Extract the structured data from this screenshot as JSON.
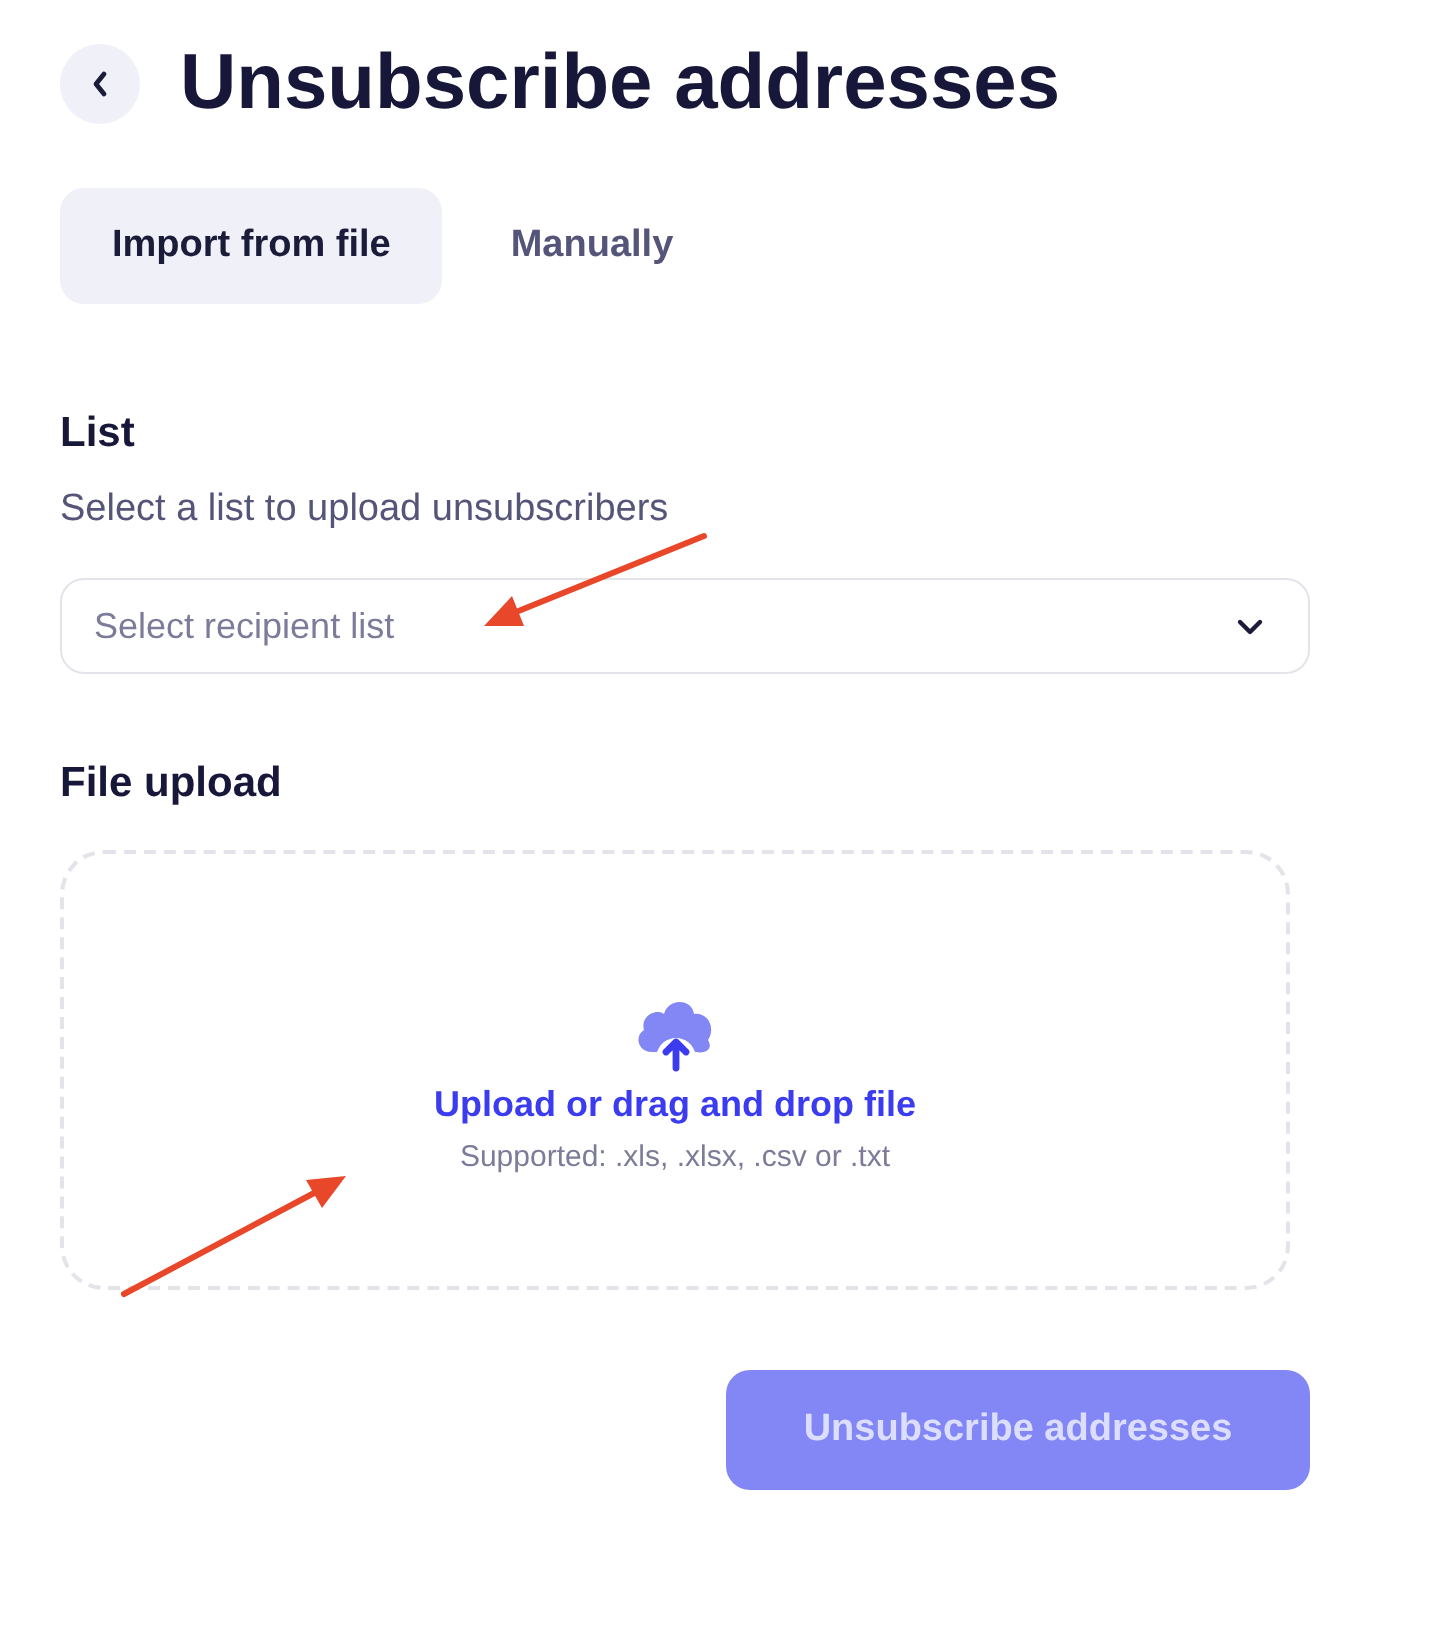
{
  "header": {
    "title": "Unsubscribe addresses"
  },
  "tabs": [
    {
      "label": "Import from file",
      "selected": true
    },
    {
      "label": "Manually",
      "selected": false
    }
  ],
  "list_section": {
    "label": "List",
    "description": "Select a list to upload unsubscribers",
    "select": {
      "placeholder": "Select recipient list"
    }
  },
  "upload_section": {
    "label": "File upload",
    "dropzone": {
      "action": "Upload or drag and drop file",
      "hint": "Supported: .xls, .xlsx, .csv or .txt"
    }
  },
  "submit_button": {
    "label": "Unsubscribe addresses",
    "disabled": true
  }
}
